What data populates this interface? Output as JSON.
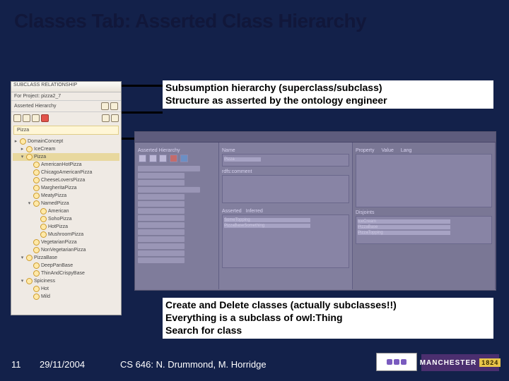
{
  "title": "Classes Tab: Asserted Class Hierarchy",
  "annotations": {
    "top": {
      "l1": "Subsumption hierarchy (superclass/subclass)",
      "l2": "Structure as asserted by the ontology engineer"
    },
    "bottom": {
      "l1": "Create and Delete classes (actually subclasses!!)",
      "l2": "Everything is a subclass of owl:Thing",
      "l3": "Search for class"
    }
  },
  "sidebar": {
    "header": "SUBCLASS RELATIONSHIP",
    "forProject": "For Project: ",
    "projectName": "pizza2_7",
    "assertedHierarchy": "Asserted Hierarchy",
    "selected": "Pizza",
    "tree": [
      {
        "tw": "▸",
        "lbl": "DomainConcept",
        "ind": 0
      },
      {
        "tw": "▸",
        "lbl": "IceCream",
        "ind": 1
      },
      {
        "tw": "▾",
        "lbl": "Pizza",
        "ind": 1,
        "sel": true
      },
      {
        "tw": "",
        "lbl": "AmericanHotPizza",
        "ind": 2
      },
      {
        "tw": "",
        "lbl": "ChicagoAmericanPizza",
        "ind": 2
      },
      {
        "tw": "",
        "lbl": "CheeseLoversPizza",
        "ind": 2
      },
      {
        "tw": "",
        "lbl": "MargheritaPizza",
        "ind": 2
      },
      {
        "tw": "",
        "lbl": "MeatyPizza",
        "ind": 2
      },
      {
        "tw": "▾",
        "lbl": "NamedPizza",
        "ind": 2
      },
      {
        "tw": "",
        "lbl": "American",
        "ind": 3
      },
      {
        "tw": "",
        "lbl": "SohoPizza",
        "ind": 3
      },
      {
        "tw": "",
        "lbl": "HotPizza",
        "ind": 3
      },
      {
        "tw": "",
        "lbl": "MushroomPizza",
        "ind": 3
      },
      {
        "tw": "",
        "lbl": "VegetarianPizza",
        "ind": 2
      },
      {
        "tw": "",
        "lbl": "NonVegetarianPizza",
        "ind": 2
      },
      {
        "tw": "▾",
        "lbl": "PizzaBase",
        "ind": 1
      },
      {
        "tw": "",
        "lbl": "DeepPanBase",
        "ind": 2
      },
      {
        "tw": "",
        "lbl": "ThinAndCrispyBase",
        "ind": 2
      },
      {
        "tw": "▾",
        "lbl": "Spiciness",
        "ind": 1
      },
      {
        "tw": "",
        "lbl": "Hot",
        "ind": 2
      },
      {
        "tw": "",
        "lbl": "Mild",
        "ind": 2
      }
    ]
  },
  "editor": {
    "colA": {
      "title": "Asserted Hierarchy"
    },
    "colB": {
      "nameLabel": "Name",
      "nameValue": "Pizza",
      "documentationLabel": "rdfs:comment",
      "assertedLabel": "Asserted",
      "inferredLabel": "Inferred",
      "cond1": "SomeTopping",
      "cond2": "PizzaBaseSomething"
    },
    "colC": {
      "propLabel": "Property",
      "valLabel": "Value",
      "langLabel": "Lang",
      "disjLabel": "Disjoints",
      "disj1": "IceCream",
      "disj2": "PizzaBase",
      "disj3": "PizzaTopping"
    }
  },
  "footer": {
    "slide": "11",
    "date": "29/11/2004",
    "course": "CS 646: N. Drummond, M. Horridge",
    "uni": "MANCHESTER",
    "year": "1824"
  }
}
